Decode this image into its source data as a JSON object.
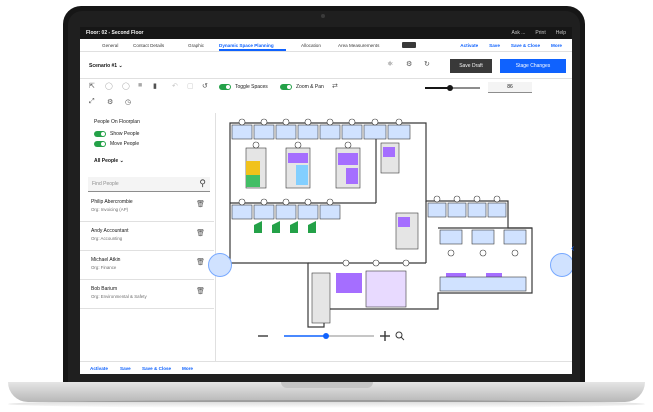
{
  "window": {
    "title": "Floor: 02 - Second Floor"
  },
  "topbar": {
    "right_items": [
      "Ask ...",
      "Print",
      "Help"
    ]
  },
  "tabs": [
    {
      "label": "General"
    },
    {
      "label": "Contact Details"
    },
    {
      "label": "Graphic"
    },
    {
      "label": "Dynamic Space Planning",
      "active": true
    },
    {
      "label": "Allocation"
    },
    {
      "label": "Area Measurements"
    }
  ],
  "tab_actions": [
    "Activate",
    "Save",
    "Save & Close",
    "More"
  ],
  "scenario": {
    "label": "Scenario #1"
  },
  "buttons": {
    "draft": "Save Draft",
    "stage": "Stage Changes"
  },
  "toggles": {
    "spaces": "Toggle Spaces",
    "zoom_pan": "Zoom & Pan"
  },
  "zoom": {
    "value": "86",
    "level": 0.45
  },
  "people_panel": {
    "title": "People On Floorplan",
    "show_people": "Show People",
    "move_people": "Move People",
    "filter": "All People",
    "search_placeholder": "Find People",
    "people": [
      {
        "name": "Philip Abercrombie",
        "org": "Org: Invoicing (AP)"
      },
      {
        "name": "Andy Accountant",
        "org": "Org: Accounting"
      },
      {
        "name": "Michael Atkin",
        "org": "Org: Finance"
      },
      {
        "name": "Bob Barium",
        "org": "Org: Environmental & Safety"
      }
    ]
  },
  "bottom_actions": [
    "Activate",
    "Save",
    "Save & Close",
    "More"
  ],
  "colors": {
    "accent": "#0f62fe",
    "toggle_on": "#24a148",
    "room_purple": "#a56eff",
    "room_blue": "#82cfff",
    "room_yellow": "#f1c21b",
    "room_green": "#42be65",
    "wall": "#393939"
  },
  "icons": [
    "lock-icon",
    "gear-icon",
    "refresh-icon",
    "trash-icon",
    "search-icon",
    "expand-icon",
    "settings-icon",
    "history-icon",
    "minus-icon",
    "plus-icon",
    "zoom-fit-icon",
    "chevron-right-icon"
  ]
}
